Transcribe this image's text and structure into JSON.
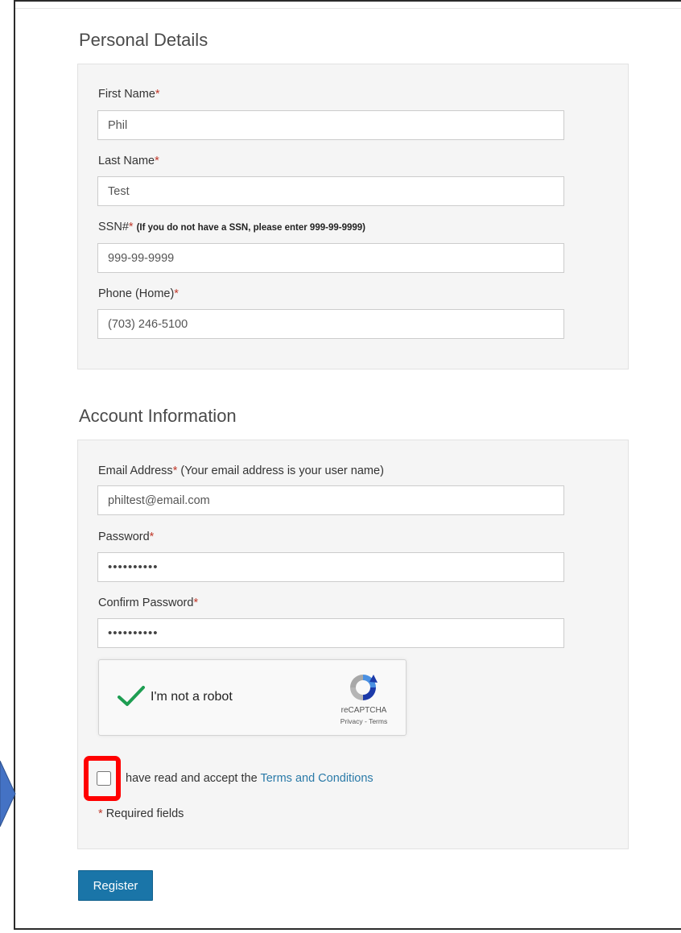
{
  "personal": {
    "title": "Personal Details",
    "first_name": {
      "label": "First Name",
      "value": "Phil"
    },
    "last_name": {
      "label": "Last Name",
      "value": "Test"
    },
    "ssn": {
      "label": "SSN#",
      "note": "(If you do not have a SSN, please enter 999-99-9999)",
      "value": "999-99-9999"
    },
    "phone": {
      "label": "Phone (Home)",
      "value": "(703) 246-5100"
    }
  },
  "account": {
    "title": "Account Information",
    "email": {
      "label": "Email Address",
      "note": "(Your email address is your user name)",
      "value": "philtest@email.com"
    },
    "password": {
      "label": "Password",
      "value": "••••••••••"
    },
    "confirm_password": {
      "label": "Confirm Password",
      "value": "••••••••••"
    }
  },
  "required_marker": "*",
  "recaptcha": {
    "label": "I'm not a robot",
    "brand": "reCAPTCHA",
    "links": "Privacy - Terms",
    "checked": true
  },
  "terms": {
    "text": "have read and accept the",
    "link": "Terms and Conditions",
    "checked": false
  },
  "required_note": "Required fields",
  "register_button": "Register",
  "colors": {
    "accent": "#1a75a8",
    "link": "#2a7aa8",
    "required": "#c0392b",
    "highlight": "#ff0000",
    "pointer": "#4472c4"
  }
}
